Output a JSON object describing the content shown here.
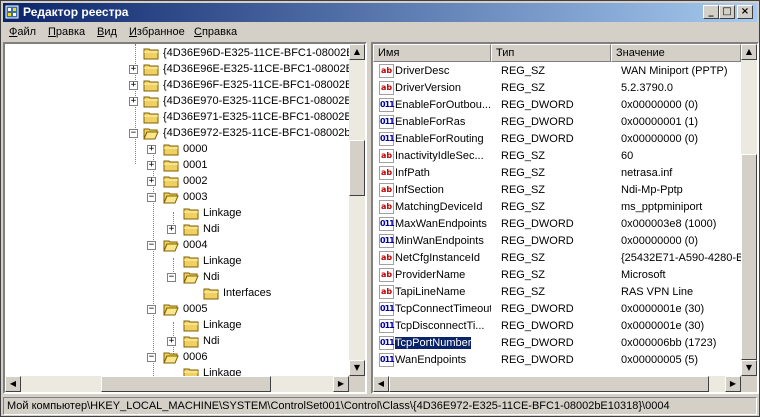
{
  "window": {
    "title": "Редактор реестра"
  },
  "menu": [
    {
      "label": "Файл",
      "u": "Ф",
      "rest": "айл"
    },
    {
      "label": "Правка",
      "u": "П",
      "rest": "равка"
    },
    {
      "label": "Вид",
      "u": "В",
      "rest": "ид"
    },
    {
      "label": "Избранное",
      "u": "И",
      "rest": "збранное"
    },
    {
      "label": "Справка",
      "u": "С",
      "rest": "правка"
    }
  ],
  "tree": {
    "items": [
      {
        "label": "{4D36E96D-E325-11CE-BFC1-08002BE",
        "expander": ""
      },
      {
        "label": "{4D36E96E-E325-11CE-BFC1-08002BE",
        "expander": "+"
      },
      {
        "label": "{4D36E96F-E325-11CE-BFC1-08002BE",
        "expander": "+"
      },
      {
        "label": "{4D36E970-E325-11CE-BFC1-08002BE",
        "expander": "+"
      },
      {
        "label": "{4D36E971-E325-11CE-BFC1-08002BE",
        "expander": ""
      },
      {
        "label": "{4D36E972-E325-11CE-BFC1-08002bE",
        "expander": "−"
      },
      {
        "label": "0000",
        "expander": "+"
      },
      {
        "label": "0001",
        "expander": "+"
      },
      {
        "label": "0002",
        "expander": "+"
      },
      {
        "label": "0003",
        "expander": "−"
      },
      {
        "label": "Linkage",
        "expander": ""
      },
      {
        "label": "Ndi",
        "expander": "+"
      },
      {
        "label": "0004",
        "expander": "−"
      },
      {
        "label": "Linkage",
        "expander": ""
      },
      {
        "label": "Ndi",
        "expander": "−"
      },
      {
        "label": "Interfaces",
        "expander": ""
      },
      {
        "label": "0005",
        "expander": "−"
      },
      {
        "label": "Linkage",
        "expander": ""
      },
      {
        "label": "Ndi",
        "expander": "+"
      },
      {
        "label": "0006",
        "expander": "−"
      },
      {
        "label": "Linkage",
        "expander": ""
      }
    ]
  },
  "list": {
    "columns": {
      "name": "Имя",
      "type": "Тип",
      "data": "Значение"
    },
    "rows": [
      {
        "name": "DriverDesc",
        "type": "REG_SZ",
        "data": "WAN Miniport (PPTP)",
        "icon": "ab"
      },
      {
        "name": "DriverVersion",
        "type": "REG_SZ",
        "data": "5.2.3790.0",
        "icon": "ab"
      },
      {
        "name": "EnableForOutbou...",
        "type": "REG_DWORD",
        "data": "0x00000000 (0)",
        "icon": "011"
      },
      {
        "name": "EnableForRas",
        "type": "REG_DWORD",
        "data": "0x00000001 (1)",
        "icon": "011"
      },
      {
        "name": "EnableForRouting",
        "type": "REG_DWORD",
        "data": "0x00000000 (0)",
        "icon": "011"
      },
      {
        "name": "InactivityIdleSec...",
        "type": "REG_SZ",
        "data": "60",
        "icon": "ab"
      },
      {
        "name": "InfPath",
        "type": "REG_SZ",
        "data": "netrasa.inf",
        "icon": "ab"
      },
      {
        "name": "InfSection",
        "type": "REG_SZ",
        "data": "Ndi-Mp-Pptp",
        "icon": "ab"
      },
      {
        "name": "MatchingDeviceId",
        "type": "REG_SZ",
        "data": "ms_pptpminiport",
        "icon": "ab"
      },
      {
        "name": "MaxWanEndpoints",
        "type": "REG_DWORD",
        "data": "0x000003e8 (1000)",
        "icon": "011"
      },
      {
        "name": "MinWanEndpoints",
        "type": "REG_DWORD",
        "data": "0x00000000 (0)",
        "icon": "011"
      },
      {
        "name": "NetCfgInstanceId",
        "type": "REG_SZ",
        "data": "{25432E71-A590-4280-B",
        "icon": "ab"
      },
      {
        "name": "ProviderName",
        "type": "REG_SZ",
        "data": "Microsoft",
        "icon": "ab"
      },
      {
        "name": "TapiLineName",
        "type": "REG_SZ",
        "data": "RAS VPN Line",
        "icon": "ab"
      },
      {
        "name": "TcpConnectTimeout",
        "type": "REG_DWORD",
        "data": "0x0000001e (30)",
        "icon": "011"
      },
      {
        "name": "TcpDisconnectTi...",
        "type": "REG_DWORD",
        "data": "0x0000001e (30)",
        "icon": "011"
      },
      {
        "name": "TcpPortNumber",
        "type": "REG_DWORD",
        "data": "0x000006bb (1723)",
        "icon": "011",
        "selected": true
      },
      {
        "name": "WanEndpoints",
        "type": "REG_DWORD",
        "data": "0x00000005 (5)",
        "icon": "011"
      }
    ]
  },
  "status": "Мой компьютер\\HKEY_LOCAL_MACHINE\\SYSTEM\\ControlSet001\\Control\\Class\\{4D36E972-E325-11CE-BFC1-08002bE10318}\\0004"
}
